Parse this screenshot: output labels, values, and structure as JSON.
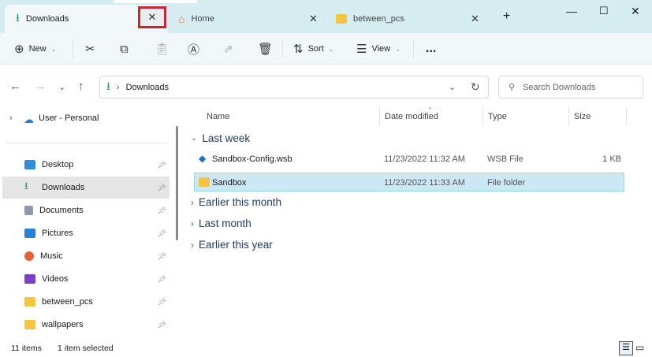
{
  "tabs": [
    {
      "label": "Downloads",
      "active": true
    },
    {
      "label": "Home"
    },
    {
      "label": "between_pcs"
    }
  ],
  "toolbar": {
    "new": "New",
    "sort": "Sort",
    "view": "View",
    "more": "..."
  },
  "address": {
    "crumb": "Downloads"
  },
  "search": {
    "placeholder": "Search Downloads"
  },
  "sidebar": {
    "account": "User - Personal",
    "items": [
      {
        "label": "Desktop",
        "color": "#2f8fd8"
      },
      {
        "label": "Downloads",
        "color": "#1aa05a"
      },
      {
        "label": "Documents",
        "color": "#8a9aaa"
      },
      {
        "label": "Pictures",
        "color": "#2a7fd4"
      },
      {
        "label": "Music",
        "color": "#e0623a"
      },
      {
        "label": "Videos",
        "color": "#7a3fc4"
      },
      {
        "label": "between_pcs",
        "color": "#f4c542"
      },
      {
        "label": "wallpapers",
        "color": "#f4c542"
      }
    ]
  },
  "columns": {
    "name": "Name",
    "date": "Date modified",
    "type": "Type",
    "size": "Size"
  },
  "groups": [
    "Last week",
    "Earlier this month",
    "Last month",
    "Earlier this year"
  ],
  "files": [
    {
      "name": "Sandbox-Config.wsb",
      "date": "11/23/2022 11:32 AM",
      "type": "WSB File",
      "size": "1 KB"
    },
    {
      "name": "Sandbox",
      "date": "11/23/2022 11:33 AM",
      "type": "File folder",
      "size": ""
    }
  ],
  "status": {
    "count": "11 items",
    "selected": "1 item selected"
  }
}
